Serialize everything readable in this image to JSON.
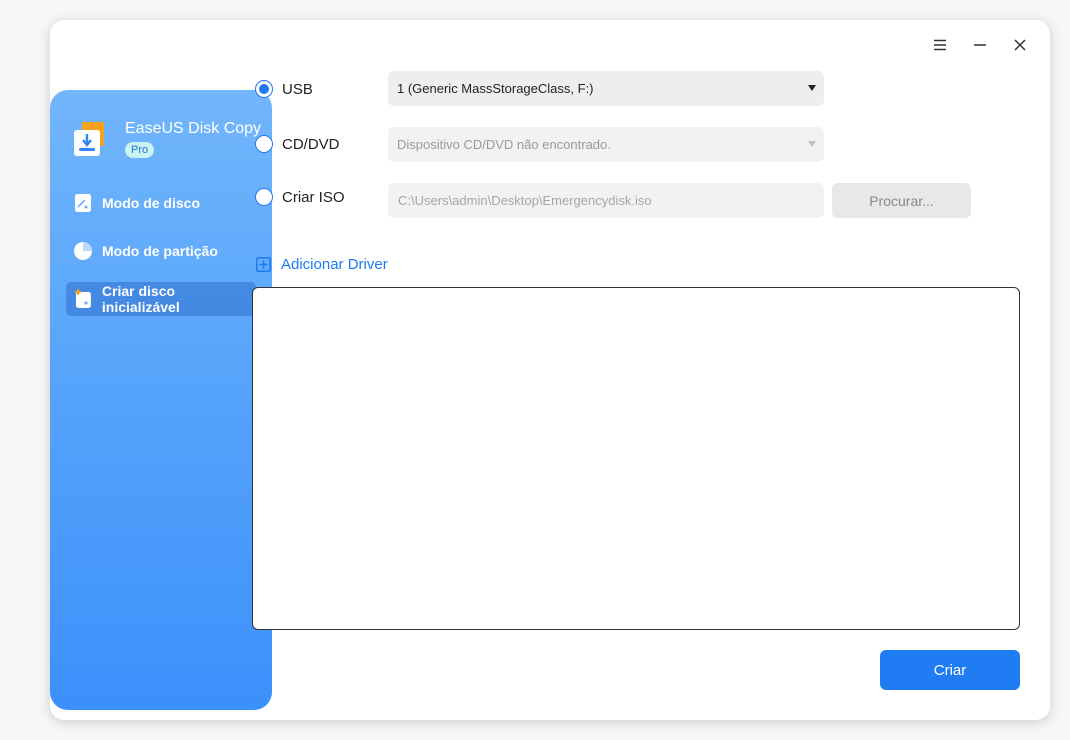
{
  "window_controls": [
    "menu-icon",
    "minimize-icon",
    "close-icon"
  ],
  "brand": {
    "name": "EaseUS Disk Copy",
    "badge": "Pro",
    "icon": "disk-copy-logo-icon"
  },
  "sidebar": {
    "items": [
      {
        "label": "Modo de disco",
        "icon": "disk-icon",
        "active": false
      },
      {
        "label": "Modo de partição",
        "icon": "pie-partition-icon",
        "active": false
      },
      {
        "label": "Criar disco inicializável",
        "icon": "bootable-disk-icon",
        "active": true
      }
    ]
  },
  "options": {
    "usb": {
      "label": "USB",
      "selected": true,
      "value": "1 (Generic MassStorageClass, F:)"
    },
    "cddvd": {
      "label": "CD/DVD",
      "selected": false,
      "value": "Dispositivo CD/DVD não encontrado."
    },
    "iso": {
      "label": "Criar ISO",
      "selected": false,
      "path": "C:\\Users\\admin\\Desktop\\Emergencydisk.iso",
      "browse_label": "Procurar..."
    }
  },
  "add_driver": {
    "label": "Adicionar Driver",
    "icon": "plus-square-icon"
  },
  "actions": {
    "create_label": "Criar"
  },
  "colors": {
    "accent": "#1e7af0",
    "sidebar_top": "#72b6fb",
    "sidebar_bottom": "#3c90fb"
  }
}
